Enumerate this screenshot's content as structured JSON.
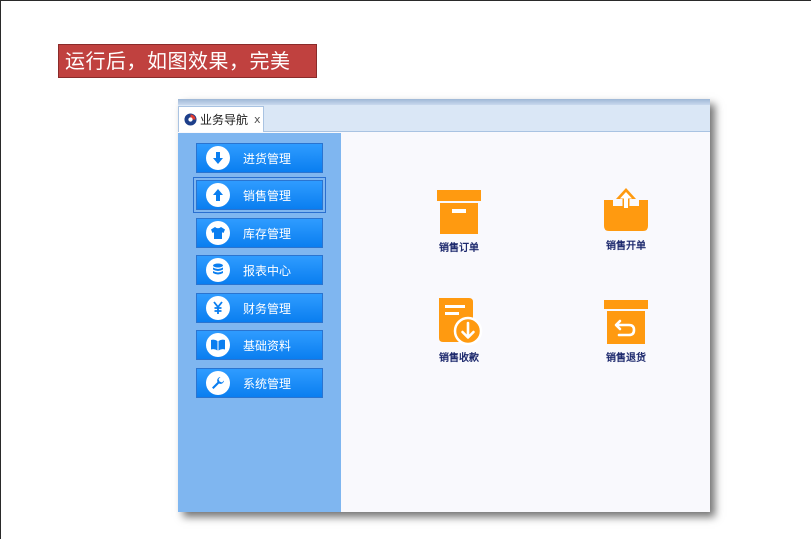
{
  "caption": "运行后，如图效果，完美",
  "tab": {
    "label": "业务导航",
    "close": "x"
  },
  "sidebar": {
    "items": [
      {
        "label": "进货管理",
        "icon": "arrow-down-icon"
      },
      {
        "label": "销售管理",
        "icon": "arrow-up-icon",
        "active": true
      },
      {
        "label": "库存管理",
        "icon": "tshirt-icon"
      },
      {
        "label": "报表中心",
        "icon": "database-icon"
      },
      {
        "label": "财务管理",
        "icon": "yen-icon"
      },
      {
        "label": "基础资料",
        "icon": "book-icon"
      },
      {
        "label": "系统管理",
        "icon": "wrench-icon"
      }
    ]
  },
  "tiles": [
    {
      "label": "销售订单",
      "icon": "archive-box-icon"
    },
    {
      "label": "销售开单",
      "icon": "inbox-upload-icon"
    },
    {
      "label": "销售收款",
      "icon": "document-download-icon"
    },
    {
      "label": "销售退货",
      "icon": "box-return-icon"
    }
  ],
  "colors": {
    "caption_bg": "#c0413f",
    "sidebar_bg": "#7fb6f0",
    "button_blue": "#0a7ef0",
    "tile_orange": "#ff9a10",
    "tile_label": "#1e2a6e"
  }
}
